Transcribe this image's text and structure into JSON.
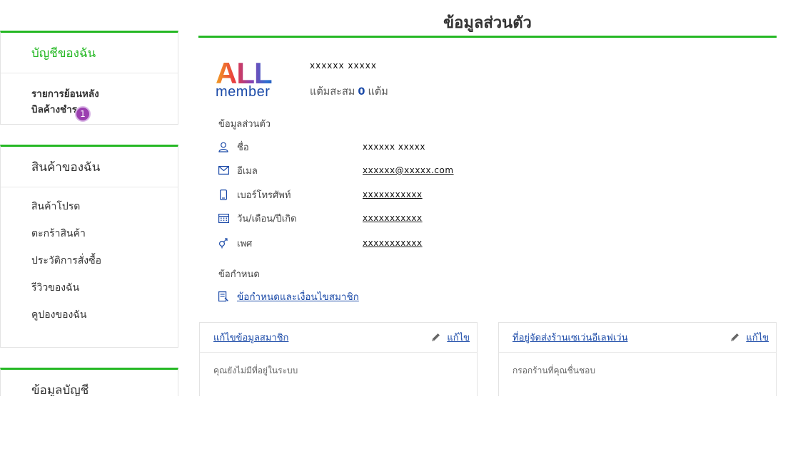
{
  "sidebar": {
    "account_title": "บัญชีของฉัน",
    "account_items": [
      "รายการย้อนหลัง",
      "บิลค้างชำระ"
    ],
    "badge_count": "1",
    "products_title": "สินค้าของฉัน",
    "products_items": [
      "สินค้าโปรด",
      "ตะกร้าสินค้า",
      "ประวัติการสั่งซื้อ",
      "รีวิวของฉัน",
      "คูปองของฉัน"
    ],
    "account_info_title": "ข้อมูลบัญชี"
  },
  "main": {
    "page_title": "ข้อมูลส่วนตัว",
    "logo_top": "ALL",
    "logo_bottom": "member",
    "member_name": "xxxxxx  xxxxx",
    "points_prefix": "แต้มสะสม",
    "points_value": "0",
    "points_suffix": "แต้ม",
    "personal_section": "ข้อมูลส่วนตัว",
    "rows": [
      {
        "icon": "user-icon",
        "label": "ชื่อ",
        "value": "xxxxxx  xxxxx"
      },
      {
        "icon": "mail-icon",
        "label": "อีเมล",
        "value": "xxxxxx@xxxxx.com"
      },
      {
        "icon": "phone-icon",
        "label": "เบอร์โทรศัพท์",
        "value": "xxxxxxxxxxx"
      },
      {
        "icon": "calendar-icon",
        "label": "วัน/เดือน/ปีเกิด",
        "value": "xxxxxxxxxxx"
      },
      {
        "icon": "gender-icon",
        "label": "เพศ",
        "value": "xxxxxxxxxxx"
      }
    ],
    "terms_section": "ข้อกำหนด",
    "terms_link": "ข้อกำหนดและเงื่อนไขสมาชิก"
  },
  "cards": {
    "edit_member_title": "แก้ไขข้อมูลสมาชิก",
    "edit_member_body": "คุณยังไม่มีที่อยู่ในระบบ",
    "store_title": "ที่อยู่จัดส่งร้านเซเว่นอีเลฟเว่น",
    "store_body": "กรอกร้านที่คุณชื่นชอบ",
    "edit_label": "แก้ไข"
  },
  "colors": {
    "accent_green": "#25b824",
    "link_blue": "#1b4aa8",
    "badge_purple": "#9b3fb0"
  }
}
